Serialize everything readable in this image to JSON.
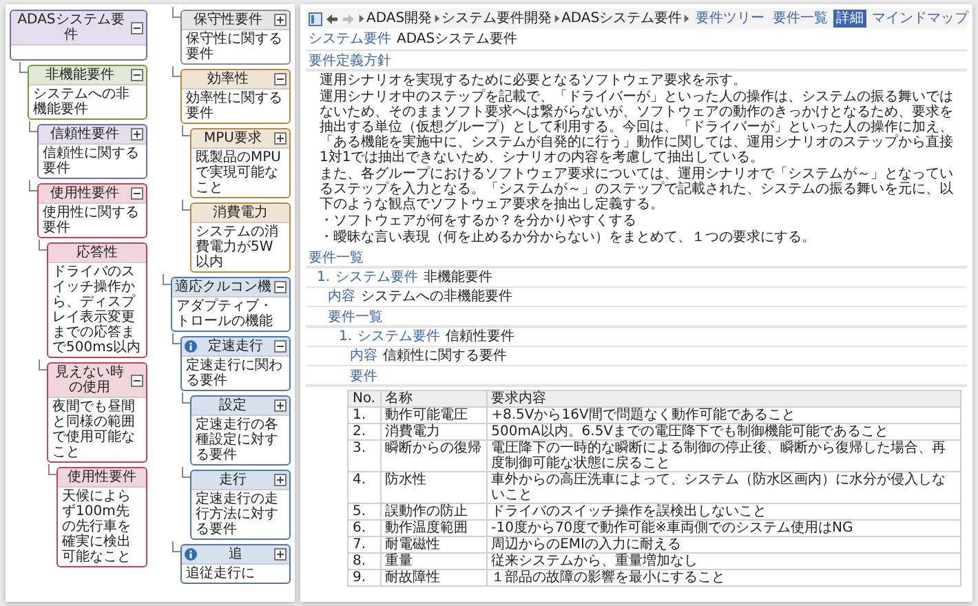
{
  "diagram": {
    "nodes": [
      {
        "title": "ADASシステム要件",
        "color": "#7b68b0",
        "info": false,
        "expanded": true,
        "children": [
          {
            "title": "非機能要件",
            "body": "システムへの非機能要件",
            "color": "#6f9a3e",
            "info": false,
            "expanded": true,
            "children": [
              {
                "title": "信頼性要件",
                "body": "信頼性に関する要件",
                "color": "#7b68b0",
                "info": false,
                "expanded": false
              },
              {
                "title": "使用性要件",
                "body": "使用性に関する要件",
                "color": "#c0405e",
                "info": false,
                "expanded": true,
                "children": [
                  {
                    "title": "応答性",
                    "body": "ドライバのスイッチ操作から、ディスプレイ表示変更までの応答まで500ms以内",
                    "color": "#c0405e",
                    "info": false
                  },
                  {
                    "title": "見えない時の使用",
                    "body": "夜間でも昼間と同様の範囲で使用可能なこと",
                    "color": "#c0405e",
                    "info": false,
                    "expanded": true,
                    "children": [
                      {
                        "title": "使用性要件",
                        "body": "天候によらず100m先の先行車を確実に検出可能なこと",
                        "color": "#c0405e",
                        "info": false
                      }
                    ]
                  }
                ]
              },
              {
                "title": "保守性要件",
                "body": "保守性に関する要件",
                "color": "#8c8c8c",
                "info": false,
                "expanded": false
              },
              {
                "title": "効率性",
                "body": "効率性に関する要件",
                "color": "#b98a3e",
                "info": false,
                "expanded": true,
                "children": [
                  {
                    "title": "MPU要求",
                    "body": "既製品のMPUで実現可能なこと",
                    "color": "#b98a3e",
                    "info": false,
                    "expanded": false
                  },
                  {
                    "title": "消費電力",
                    "body": "システムの消費電力が5W以内",
                    "color": "#b98a3e",
                    "info": false
                  }
                ]
              }
            ]
          },
          {
            "title": "適応クルコン機",
            "body": "アダプティブ・トロールの機能",
            "color": "#4a78b0",
            "info": false,
            "expanded": true,
            "children": [
              {
                "title": "定速走行",
                "body": "定速走行に関わる要件",
                "color": "#4a78b0",
                "info": true,
                "expanded": true,
                "children": [
                  {
                    "title": "設定",
                    "body": "定速走行の各種設定に対する要件",
                    "color": "#4a78b0",
                    "info": false,
                    "expanded": false
                  },
                  {
                    "title": "走行",
                    "body": "定速走行の走行方法に対する要件",
                    "color": "#4a78b0",
                    "info": false,
                    "expanded": false
                  }
                ]
              },
              {
                "title": "追",
                "body": "追従走行に",
                "color": "#4a78b0",
                "info": true,
                "expanded": false
              }
            ]
          }
        ]
      }
    ]
  },
  "document": {
    "breadcrumb": [
      "ADAS開発",
      "システム要件開発",
      "ADASシステム要件"
    ],
    "views": [
      {
        "label": "要件ツリー",
        "selected": false
      },
      {
        "label": "要件一覧",
        "selected": false
      },
      {
        "label": "詳細",
        "selected": true
      },
      {
        "label": "マインドマップ",
        "selected": false
      }
    ],
    "title": {
      "type_label": "システム要件",
      "name": "ADASシステム要件"
    },
    "policy": {
      "heading": "要件定義方針",
      "paragraphs": [
        "運用シナリオを実現するために必要となるソフトウェア要求を示す。",
        "運用シナリオ中のステップを記載で、「ドライバーが」といった人の操作は、システムの振る舞いではないため、そのままソフト要求へは繋がらないが、ソフトウェアの動作のきっかけとなるため、要求を抽出する単位（仮想グループ）として利用する。今回は、「ドライバーが」といった人の操作に加え、「ある機能を実施中に、システムが自発的に行う」動作に関しては、運用シナリオのステップから直接1対1では抽出できないため、シナリオの内容を考慮して抽出している。",
        "また、各グループにおけるソフトウェア要求については、運用シナリオで「システムが～」となっているステップを入力となる。「システムが～」のステップで記載された、システムの振る舞いを元に、以下のような観点でソフトウェア要求を抽出し定義する。"
      ],
      "bullets": [
        "・ソフトウェアが何をするか？を分かりやすくする",
        "・曖昧な言い表現（何を止めるか分からない）をまとめて、１つの要求にする。"
      ]
    },
    "requirements": {
      "heading": "要件一覧",
      "number": "1.",
      "type_label": "システム要件",
      "name": "非機能要件",
      "content_label": "内容",
      "content": "システムへの非機能要件",
      "sub": {
        "heading": "要件一覧",
        "number": "1.",
        "type_label": "システム要件",
        "name": "信頼性要件",
        "content_label": "内容",
        "content": "信頼性に関する要件",
        "table_heading": "要件",
        "table": {
          "columns": [
            "No.",
            "名称",
            "要求内容"
          ],
          "rows": [
            [
              "1.",
              "動作可能電圧",
              "+8.5Vから16V間で問題なく動作可能であること"
            ],
            [
              "2.",
              "消費電力",
              "500mA以内。6.5Vまでの電圧降下でも制御機能可能であること"
            ],
            [
              "3.",
              "瞬断からの復帰",
              "電圧降下の一時的な瞬断による制御の停止後、瞬断から復帰した場合、再度制御可能な状態に戻ること"
            ],
            [
              "4.",
              "防水性",
              "車外からの高圧洗車によって、システム（防水区画内）に水分が侵入しないこと"
            ],
            [
              "5.",
              "誤動作の防止",
              "ドライバのスイッチ操作を誤検出しないこと"
            ],
            [
              "6.",
              "動作温度範囲",
              "-10度から70度で動作可能※車両側でのシステム使用はNG"
            ],
            [
              "7.",
              "耐電磁性",
              "周辺からのEMIの入力に耐える"
            ],
            [
              "8.",
              "重量",
              "従来システムから、重量増加なし"
            ],
            [
              "9.",
              "耐故障性",
              "１部品の故障の影響を最小にすること"
            ]
          ]
        }
      }
    }
  }
}
